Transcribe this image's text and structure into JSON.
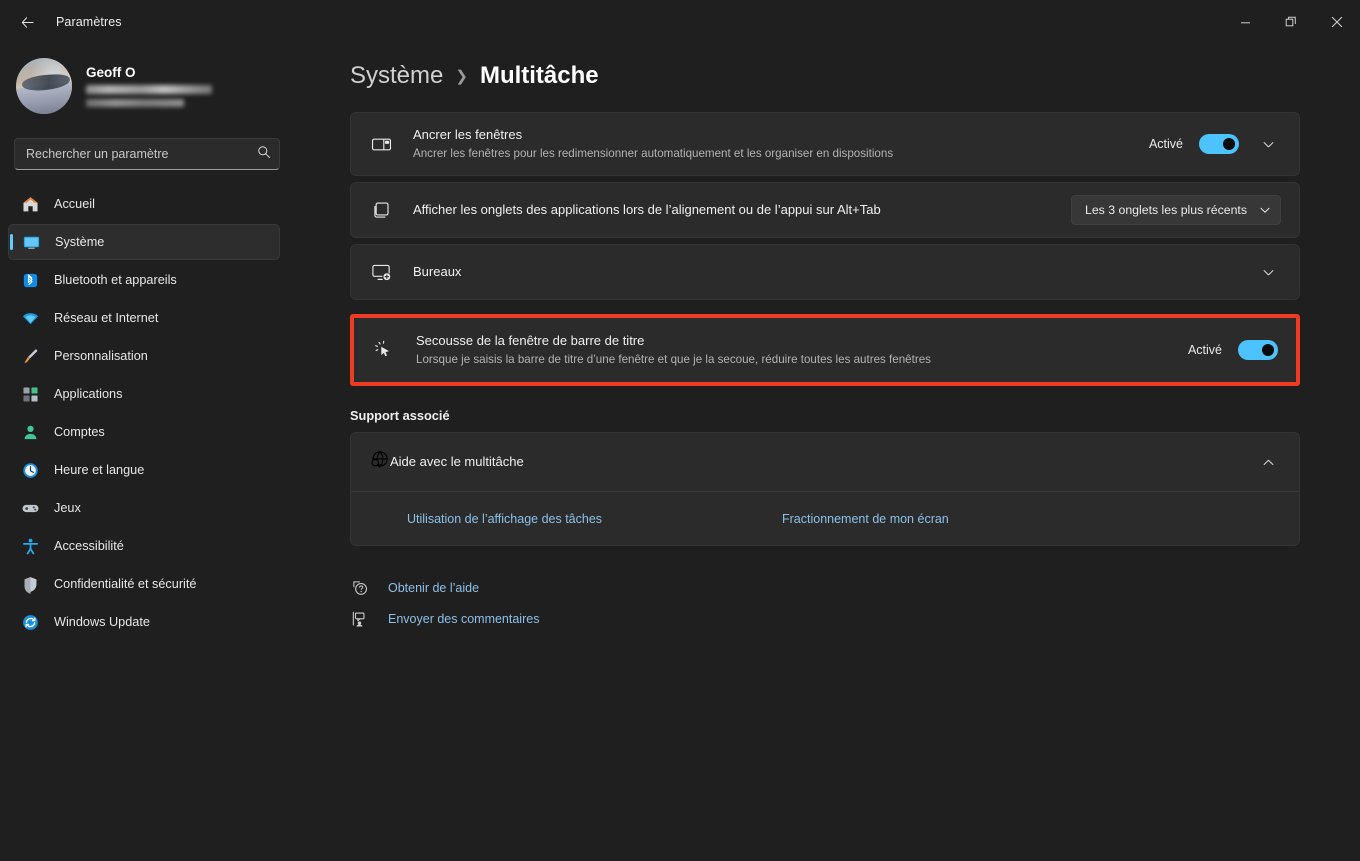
{
  "window": {
    "app_title": "Paramètres",
    "back_icon": "arrow-left-icon",
    "minimize_label": "—",
    "restore_label": "❐",
    "close_label": "✕"
  },
  "sidebar": {
    "profile": {
      "name": "Geoff O",
      "email_redacted": true,
      "avatar_icon": "avatar-photo"
    },
    "search": {
      "placeholder": "Rechercher un paramètre",
      "value": "",
      "icon": "search-icon"
    },
    "items": [
      {
        "label": "Accueil",
        "icon": "home-icon",
        "selected": false
      },
      {
        "label": "Système",
        "icon": "system-monitor-icon",
        "selected": true
      },
      {
        "label": "Bluetooth et appareils",
        "icon": "bluetooth-icon",
        "selected": false
      },
      {
        "label": "Réseau et Internet",
        "icon": "wifi-icon",
        "selected": false
      },
      {
        "label": "Personnalisation",
        "icon": "paintbrush-icon",
        "selected": false
      },
      {
        "label": "Applications",
        "icon": "apps-grid-icon",
        "selected": false
      },
      {
        "label": "Comptes",
        "icon": "person-icon",
        "selected": false
      },
      {
        "label": "Heure et langue",
        "icon": "clock-icon",
        "selected": false
      },
      {
        "label": "Jeux",
        "icon": "gamepad-icon",
        "selected": false
      },
      {
        "label": "Accessibilité",
        "icon": "accessibility-person-icon",
        "selected": false
      },
      {
        "label": "Confidentialité et sécurité",
        "icon": "shield-icon",
        "selected": false
      },
      {
        "label": "Windows Update",
        "icon": "update-refresh-icon",
        "selected": false
      }
    ]
  },
  "breadcrumb": {
    "parent": "Système",
    "separator": "❯",
    "current": "Multitâche"
  },
  "settings": {
    "snap_windows": {
      "title": "Ancrer les fenêtres",
      "description": "Ancrer les fenêtres pour les redimensionner automatiquement et les organiser en dispositions",
      "toggle_label": "Activé",
      "toggle_state": "on",
      "icon": "snap-layout-icon",
      "expand_icon": "chevron-down-icon"
    },
    "alt_tab": {
      "title": "Afficher les onglets des applications lors de l’alignement ou de l’appui sur Alt+Tab",
      "dropdown_value": "Les 3 onglets les plus récents",
      "dropdown_icon": "chevron-down-icon",
      "icon": "window-tabs-icon"
    },
    "desktops": {
      "title": "Bureaux",
      "icon": "desktop-add-icon",
      "expand_icon": "chevron-down-icon"
    },
    "title_bar_shake": {
      "title": "Secousse de la fenêtre de barre de titre",
      "description": "Lorsque je saisis la barre de titre d’une fenêtre et que je la secoue, réduire toutes les autres fenêtres",
      "toggle_label": "Activé",
      "toggle_state": "on",
      "icon": "cursor-shake-icon",
      "highlight_color": "#ee3b23"
    }
  },
  "support": {
    "section_title": "Support associé",
    "help_item": {
      "title": "Aide avec le multitâche",
      "icon": "globe-search-icon",
      "collapse_icon": "chevron-up-icon"
    },
    "links": [
      "Utilisation de l’affichage des tâches",
      "Fractionnement de mon écran"
    ]
  },
  "footer_links": [
    {
      "label": "Obtenir de l’aide",
      "icon": "help-question-icon"
    },
    {
      "label": "Envoyer des commentaires",
      "icon": "feedback-icon"
    }
  ],
  "colors": {
    "accent": "#4cc2ff",
    "selected_indicator": "#60cdff",
    "link": "#8cc0e8",
    "annotation": "#ee3b23",
    "window_bg": "#1f1f1f",
    "card_bg": "#2b2b2b"
  }
}
